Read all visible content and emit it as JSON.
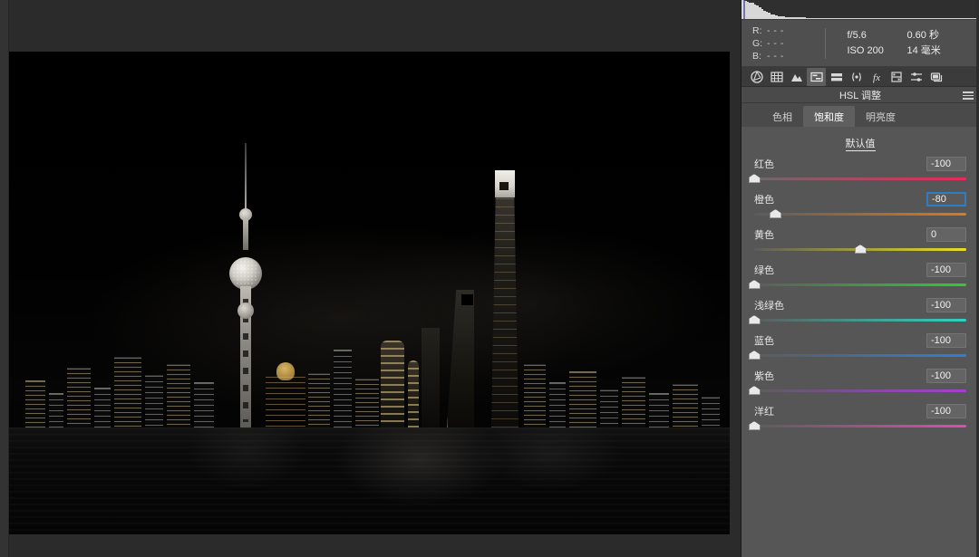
{
  "app": {
    "module": "develop",
    "panel_background": "#565656",
    "accent_focus": "#2f7ec4"
  },
  "histogram": {
    "name": "histogram",
    "description": "Tonal histogram of the photograph, heavily weighted toward the shadows",
    "bins": [
      96,
      92,
      88,
      84,
      80,
      74,
      66,
      58,
      50,
      42,
      36,
      30,
      25,
      21,
      18,
      15,
      13,
      12,
      11,
      10,
      9,
      9,
      8,
      8,
      7,
      7,
      7,
      6,
      6,
      6,
      6,
      5,
      5,
      5,
      5,
      5,
      4,
      4,
      4,
      4,
      4,
      4,
      4,
      4,
      3,
      3,
      3,
      3,
      3,
      3,
      3,
      3,
      3,
      3,
      3,
      3,
      3,
      3,
      2,
      2,
      2,
      2,
      2,
      2,
      2,
      2,
      2,
      2,
      2,
      2,
      2,
      2,
      2,
      2,
      2,
      2,
      2,
      2,
      2,
      2,
      2,
      2,
      2,
      2,
      2,
      2,
      2,
      2,
      2,
      2,
      2,
      2,
      2,
      2,
      2,
      1,
      1,
      1,
      1,
      1
    ]
  },
  "readout": {
    "r_label": "R:",
    "g_label": "G:",
    "b_label": "B:",
    "r_value": "- - -",
    "g_value": "- - -",
    "b_value": "- - -"
  },
  "exif": {
    "aperture": "f/5.6",
    "shutter": "0.60 秒",
    "iso": "ISO 200",
    "focal_length": "14 毫米"
  },
  "tool_icons": [
    {
      "name": "basic-panel-icon",
      "glyph": "aperture",
      "active": false
    },
    {
      "name": "tone-curve-icon",
      "glyph": "grid",
      "active": false
    },
    {
      "name": "detail-icon",
      "glyph": "mountain",
      "active": false
    },
    {
      "name": "hsl-color-icon",
      "glyph": "hsl",
      "active": true
    },
    {
      "name": "split-toning-icon",
      "glyph": "split",
      "active": false
    },
    {
      "name": "lens-correction-icon",
      "glyph": "lens",
      "active": false
    },
    {
      "name": "effects-icon",
      "glyph": "fx",
      "active": false
    },
    {
      "name": "calibration-icon",
      "glyph": "film",
      "active": false
    },
    {
      "name": "presets-icon",
      "glyph": "sliders",
      "active": false
    },
    {
      "name": "snapshots-icon",
      "glyph": "layers",
      "active": false
    }
  ],
  "panel": {
    "title": "HSL 调整",
    "menu_icon": "hamburger-icon",
    "default_link": "默认值"
  },
  "tabs": [
    {
      "label": "色相",
      "active": false
    },
    {
      "label": "饱和度",
      "active": true
    },
    {
      "label": "明亮度",
      "active": false
    }
  ],
  "sliders": [
    {
      "label": "红色",
      "value": "-100",
      "position": 0,
      "focused": false,
      "from": "#6b6b6b",
      "to": "#e8295b"
    },
    {
      "label": "橙色",
      "value": "-80",
      "position": 10,
      "focused": true,
      "from": "#5c5c5c",
      "to": "#e07818"
    },
    {
      "label": "黄色",
      "value": "0",
      "position": 50,
      "focused": false,
      "from": "#5c5c5c",
      "to": "#e8e020"
    },
    {
      "label": "绿色",
      "value": "-100",
      "position": 0,
      "focused": false,
      "from": "#5c5c5c",
      "to": "#2fcc34"
    },
    {
      "label": "浅绿色",
      "value": "-100",
      "position": 0,
      "focused": false,
      "from": "#5c5c5c",
      "to": "#2fd2c0"
    },
    {
      "label": "蓝色",
      "value": "-100",
      "position": 0,
      "focused": false,
      "from": "#5c5c5c",
      "to": "#2f7ed8"
    },
    {
      "label": "紫色",
      "value": "-100",
      "position": 0,
      "focused": false,
      "from": "#5c5c5c",
      "to": "#a23fd0"
    },
    {
      "label": "洋红",
      "value": "-100",
      "position": 0,
      "focused": false,
      "from": "#5c5c5c",
      "to": "#e04bb0"
    }
  ],
  "photo": {
    "name": "shanghai-pudong-skyline-night",
    "description": "夜景：上海浦东天际线与黄浦江，饱和度已大幅降低"
  }
}
